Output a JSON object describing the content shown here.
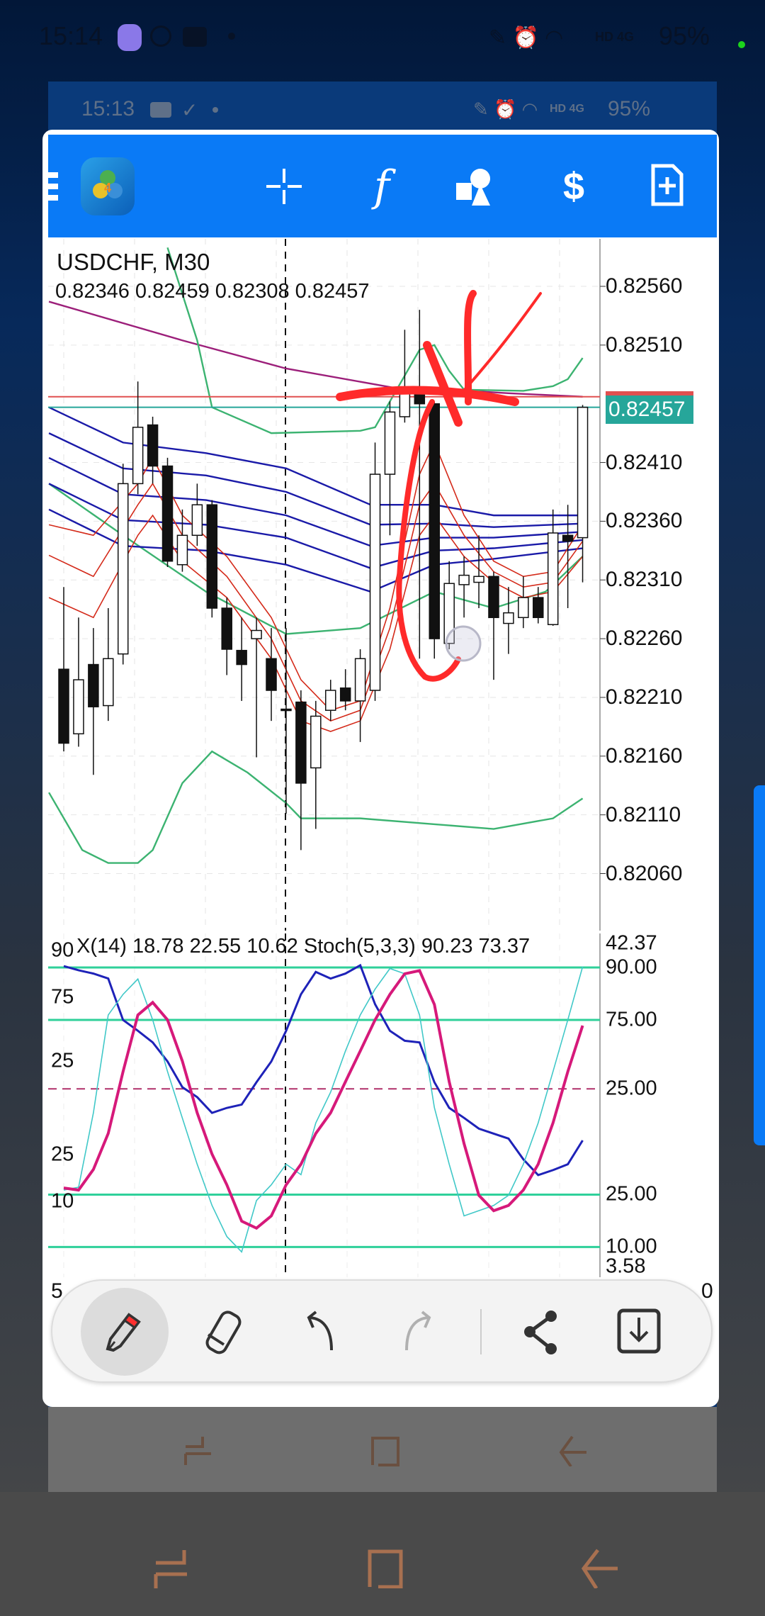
{
  "status_bar": {
    "time": "15:14",
    "network": "HD 4G",
    "battery": "95%"
  },
  "inner_status_bar": {
    "time": "15:13",
    "network": "HD 4G",
    "battery": "95%"
  },
  "toolbar": {
    "icons": [
      "menu-icon",
      "metatrader4-logo",
      "crosshair-icon",
      "indicators-icon",
      "objects-icon",
      "trade-icon",
      "new-order-icon"
    ],
    "accent": "#0a7af6"
  },
  "chart": {
    "symbol": "USDCHF, M30",
    "ohlc": "0.82346 0.82459 0.82308 0.82457",
    "price_labels": [
      "0.82560",
      "0.82510",
      "0.82410",
      "0.82360",
      "0.82310",
      "0.82260",
      "0.82210",
      "0.82160",
      "0.82110",
      "0.82060"
    ],
    "current_price": "0.82457",
    "current_price_color": "#26a69a",
    "bid_line_color": "#e05050"
  },
  "chart_data": [
    {
      "type": "candlestick",
      "title": "USDCHF, M30",
      "ylim": [
        0.8202,
        0.826
      ],
      "candles": [
        [
          0.82234,
          0.82304,
          0.82164,
          0.82171
        ],
        [
          0.82179,
          0.82278,
          0.82168,
          0.82225
        ],
        [
          0.82238,
          0.82269,
          0.82144,
          0.82202
        ],
        [
          0.82203,
          0.82286,
          0.8219,
          0.82243
        ],
        [
          0.82247,
          0.82409,
          0.82238,
          0.82392
        ],
        [
          0.82392,
          0.82479,
          0.82383,
          0.8244
        ],
        [
          0.82442,
          0.82449,
          0.82392,
          0.82407
        ],
        [
          0.82407,
          0.82414,
          0.82321,
          0.82326
        ],
        [
          0.82323,
          0.8237,
          0.82317,
          0.82348
        ],
        [
          0.82348,
          0.82392,
          0.82339,
          0.82374
        ],
        [
          0.82374,
          0.82378,
          0.82278,
          0.82286
        ],
        [
          0.82286,
          0.82295,
          0.82229,
          0.82251
        ],
        [
          0.8225,
          0.82278,
          0.82207,
          0.82238
        ],
        [
          0.8226,
          0.82278,
          0.82159,
          0.82267
        ],
        [
          0.82243,
          0.82269,
          0.8219,
          0.82216
        ],
        [
          0.822,
          0.82269,
          0.82111,
          0.82199
        ],
        [
          0.82206,
          0.82216,
          0.8208,
          0.82137
        ],
        [
          0.8215,
          0.82207,
          0.82098,
          0.82194
        ],
        [
          0.82199,
          0.82225,
          0.8219,
          0.82216
        ],
        [
          0.82218,
          0.82234,
          0.82199,
          0.82207
        ],
        [
          0.82207,
          0.82251,
          0.82172,
          0.82243
        ],
        [
          0.82216,
          0.82427,
          0.82207,
          0.824
        ],
        [
          0.824,
          0.82462,
          0.82348,
          0.82453
        ],
        [
          0.82449,
          0.82523,
          0.82444,
          0.82472
        ],
        [
          0.82471,
          0.8254,
          0.82243,
          0.8246
        ],
        [
          0.8246,
          0.82462,
          0.82243,
          0.8226
        ],
        [
          0.82256,
          0.82326,
          0.82251,
          0.82307
        ],
        [
          0.82306,
          0.8233,
          0.82278,
          0.82314
        ],
        [
          0.82308,
          0.82348,
          0.82286,
          0.82313
        ],
        [
          0.82313,
          0.82317,
          0.82225,
          0.82278
        ],
        [
          0.82273,
          0.82304,
          0.82247,
          0.82282
        ],
        [
          0.82278,
          0.82313,
          0.82269,
          0.82295
        ],
        [
          0.82295,
          0.82304,
          0.82273,
          0.82278
        ],
        [
          0.82272,
          0.8237,
          0.82271,
          0.8235
        ],
        [
          0.82348,
          0.82374,
          0.82286,
          0.82343
        ],
        [
          0.82346,
          0.82459,
          0.82308,
          0.82457
        ]
      ],
      "series": [
        {
          "name": "ma-purple",
          "color": "#9c1f7a",
          "points": [
            [
              -1,
              0.82547
            ],
            [
              8,
              0.82514
            ],
            [
              15,
              0.8249
            ],
            [
              23,
              0.82472
            ],
            [
              26,
              0.82472
            ],
            [
              30,
              0.82469
            ],
            [
              35,
              0.82466
            ]
          ]
        },
        {
          "name": "bb-upper",
          "color": "#3cb371",
          "points": [
            [
              7,
              0.82593
            ],
            [
              9,
              0.82514
            ],
            [
              10,
              0.82457
            ],
            [
              14,
              0.82435
            ],
            [
              20,
              0.82437
            ],
            [
              21,
              0.8244
            ],
            [
              23,
              0.82484
            ],
            [
              24,
              0.82506
            ],
            [
              25,
              0.8251
            ],
            [
              26,
              0.82488
            ],
            [
              27,
              0.82472
            ],
            [
              31,
              0.82471
            ],
            [
              33,
              0.82475
            ],
            [
              34,
              0.82481
            ],
            [
              35,
              0.82499
            ]
          ]
        },
        {
          "name": "bb-lower",
          "color": "#3cb371",
          "points": [
            [
              -1,
              0.82129
            ],
            [
              1.25,
              0.8208
            ],
            [
              3,
              0.82069
            ],
            [
              5,
              0.82069
            ],
            [
              6,
              0.8208
            ],
            [
              8,
              0.82137
            ],
            [
              10,
              0.82164
            ],
            [
              12.4,
              0.82146
            ],
            [
              15,
              0.8212
            ],
            [
              16,
              0.82107
            ],
            [
              20,
              0.82107
            ],
            [
              25,
              0.82102
            ],
            [
              29,
              0.82098
            ],
            [
              33,
              0.82107
            ],
            [
              35,
              0.82124
            ]
          ]
        },
        {
          "name": "bb-middle",
          "color": "#3cb371",
          "points": [
            [
              -1,
              0.82392
            ],
            [
              4,
              0.82348
            ],
            [
              9.6,
              0.823
            ],
            [
              15,
              0.82264
            ],
            [
              20,
              0.82269
            ],
            [
              25,
              0.823
            ],
            [
              29,
              0.82286
            ],
            [
              32.5,
              0.823
            ],
            [
              35,
              0.8233
            ]
          ]
        },
        {
          "name": "ma-blue-1",
          "color": "#1a1aa8",
          "points": [
            [
              -1,
              0.82457
            ],
            [
              4,
              0.82427
            ],
            [
              9.6,
              0.82418
            ],
            [
              15,
              0.82405
            ],
            [
              20.7,
              0.82374
            ],
            [
              25,
              0.82374
            ],
            [
              29,
              0.82365
            ],
            [
              35,
              0.82365
            ]
          ]
        },
        {
          "name": "ma-blue-2",
          "color": "#1a1aa8",
          "points": [
            [
              -1,
              0.82435
            ],
            [
              4,
              0.82405
            ],
            [
              9.6,
              0.82399
            ],
            [
              15,
              0.82385
            ],
            [
              20.7,
              0.82357
            ],
            [
              25,
              0.82358
            ],
            [
              29,
              0.82355
            ],
            [
              35,
              0.82358
            ]
          ]
        },
        {
          "name": "ma-blue-3",
          "color": "#1a1aa8",
          "points": [
            [
              -1,
              0.82414
            ],
            [
              4,
              0.82383
            ],
            [
              9.6,
              0.82378
            ],
            [
              15,
              0.82365
            ],
            [
              20.7,
              0.82339
            ],
            [
              25,
              0.82346
            ],
            [
              29,
              0.82346
            ],
            [
              35,
              0.82351
            ]
          ]
        },
        {
          "name": "ma-blue-4",
          "color": "#1a1aa8",
          "points": [
            [
              -1,
              0.82392
            ],
            [
              4,
              0.82361
            ],
            [
              9.6,
              0.82357
            ],
            [
              15,
              0.82346
            ],
            [
              20.7,
              0.8232
            ],
            [
              25,
              0.82335
            ],
            [
              29,
              0.82337
            ],
            [
              35,
              0.82344
            ]
          ]
        },
        {
          "name": "ma-blue-5",
          "color": "#1a1aa8",
          "points": [
            [
              -1,
              0.8237
            ],
            [
              4,
              0.82339
            ],
            [
              9.6,
              0.82335
            ],
            [
              15,
              0.82323
            ],
            [
              20.7,
              0.823
            ],
            [
              25,
              0.82323
            ],
            [
              29,
              0.82328
            ],
            [
              35,
              0.82337
            ]
          ]
        },
        {
          "name": "ma-red-1",
          "color": "#d42a1a",
          "points": [
            [
              -1,
              0.82357
            ],
            [
              2,
              0.82348
            ],
            [
              5,
              0.82392
            ],
            [
              6,
              0.82414
            ],
            [
              8,
              0.82365
            ],
            [
              11,
              0.8233
            ],
            [
              14,
              0.82278
            ],
            [
              16,
              0.82225
            ],
            [
              18,
              0.82199
            ],
            [
              20,
              0.82207
            ],
            [
              22,
              0.82286
            ],
            [
              24,
              0.824
            ],
            [
              25,
              0.82427
            ],
            [
              27,
              0.82365
            ],
            [
              29,
              0.82326
            ],
            [
              31,
              0.82313
            ],
            [
              33,
              0.82317
            ],
            [
              35,
              0.82357
            ]
          ]
        },
        {
          "name": "ma-red-2",
          "color": "#d42a1a",
          "points": [
            [
              -1,
              0.82331
            ],
            [
              2,
              0.82313
            ],
            [
              5,
              0.82374
            ],
            [
              6,
              0.82392
            ],
            [
              8,
              0.82348
            ],
            [
              11,
              0.82313
            ],
            [
              14,
              0.8226
            ],
            [
              16,
              0.82207
            ],
            [
              18,
              0.8219
            ],
            [
              20,
              0.82199
            ],
            [
              22,
              0.82269
            ],
            [
              24,
              0.82374
            ],
            [
              25,
              0.82392
            ],
            [
              27,
              0.82348
            ],
            [
              29,
              0.82317
            ],
            [
              31,
              0.82304
            ],
            [
              33,
              0.82308
            ],
            [
              35,
              0.82343
            ]
          ]
        },
        {
          "name": "ma-red-3",
          "color": "#d42a1a",
          "points": [
            [
              -1,
              0.82295
            ],
            [
              2,
              0.82278
            ],
            [
              5,
              0.82348
            ],
            [
              6,
              0.82365
            ],
            [
              8,
              0.82326
            ],
            [
              11,
              0.82295
            ],
            [
              14,
              0.82243
            ],
            [
              16,
              0.8219
            ],
            [
              18,
              0.82181
            ],
            [
              20,
              0.8219
            ],
            [
              22,
              0.82251
            ],
            [
              24,
              0.82348
            ],
            [
              25,
              0.82365
            ],
            [
              27,
              0.8233
            ],
            [
              29,
              0.82308
            ],
            [
              31,
              0.82295
            ],
            [
              33,
              0.823
            ],
            [
              35,
              0.8233
            ]
          ]
        }
      ]
    },
    {
      "type": "line",
      "title": "X(14) 18.78 22.55 10.62 Stoch(5,3,3) 90.23 73.37",
      "stoch_levels": [
        "90.00",
        "75.00",
        "25.00",
        "10.00"
      ],
      "adx_range": [
        "42.37",
        "3.58"
      ],
      "adx_level": "25.00",
      "left_labels": [
        "90",
        "75",
        "25",
        "25",
        "10"
      ],
      "stoch_main": {
        "color": "#40c8c8",
        "values": [
          26.3,
          27.1,
          48.4,
          76.4,
          82.3,
          86.7,
          75,
          60.2,
          46.9,
          33.7,
          21.9,
          13,
          8.6,
          23.3,
          27.8,
          33.7,
          30.7,
          45.5,
          54.3,
          66.1,
          76.4,
          83.8,
          89.7,
          88.2,
          76.4,
          49.9,
          33.7,
          18.9,
          20.4,
          21.9,
          24.8,
          33.7,
          45.5,
          60.2,
          75,
          90.23
        ]
      },
      "stoch_signal": {
        "color": "#d6197a",
        "values": [
          26.9,
          26.3,
          32.2,
          42.5,
          60.2,
          76.4,
          80,
          75,
          63.2,
          48.4,
          36.6,
          27.8,
          17.4,
          15.4,
          18.9,
          27.8,
          33.7,
          42.5,
          48.4,
          57.3,
          66.1,
          75,
          82.3,
          88.2,
          89.1,
          79.4,
          57.3,
          39.6,
          24.8,
          20.4,
          21.9,
          26.3,
          33.7,
          45.5,
          60.2,
          73.37
        ]
      },
      "adx": {
        "color": "#1e22b8",
        "values": [
          39.8,
          39.3,
          38.9,
          38.3,
          33.3,
          32.0,
          30.6,
          28.3,
          25.2,
          24.0,
          22.1,
          22.7,
          23.1,
          25.8,
          28.3,
          32,
          36.4,
          39.1,
          38.3,
          38.9,
          39.9,
          35.2,
          32,
          30.8,
          30.6,
          25.8,
          22.7,
          21.5,
          20.2,
          19.6,
          19.0,
          16.5,
          14.6,
          15.2,
          15.9,
          18.78
        ]
      }
    }
  ],
  "time_axis": {
    "left": "5",
    "right": "0"
  },
  "draw_toolbar": {
    "tools": [
      "pen-tool",
      "eraser-tool",
      "undo",
      "redo",
      "share",
      "save"
    ],
    "active": "pen-tool"
  }
}
